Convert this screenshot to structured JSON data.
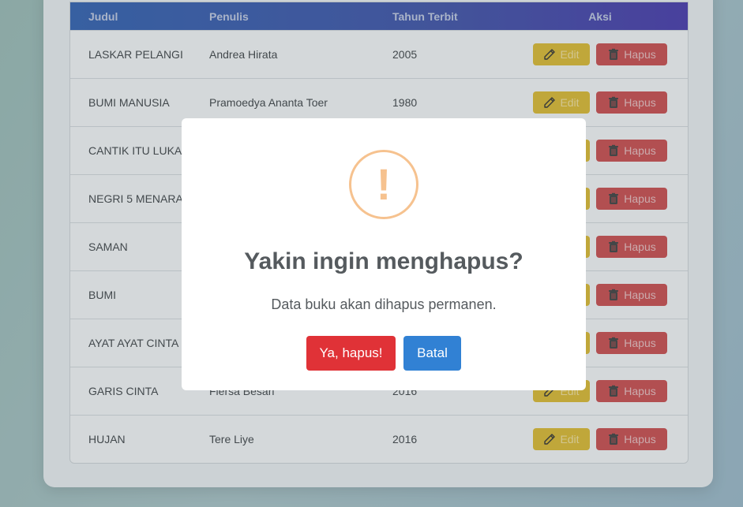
{
  "table": {
    "headers": {
      "judul": "Judul",
      "penulis": "Penulis",
      "tahun": "Tahun Terbit",
      "aksi": "Aksi"
    },
    "edit_label": "Edit",
    "hapus_label": "Hapus",
    "rows": [
      {
        "judul": "LASKAR PELANGI",
        "penulis": "Andrea Hirata",
        "tahun": "2005"
      },
      {
        "judul": "BUMI MANUSIA",
        "penulis": "Pramoedya Ananta Toer",
        "tahun": "1980"
      },
      {
        "judul": "CANTIK ITU LUKA",
        "penulis": "",
        "tahun": ""
      },
      {
        "judul": "NEGRI 5 MENARA",
        "penulis": "",
        "tahun": ""
      },
      {
        "judul": "SAMAN",
        "penulis": "",
        "tahun": ""
      },
      {
        "judul": "BUMI",
        "penulis": "",
        "tahun": ""
      },
      {
        "judul": "AYAT AYAT CINTA",
        "penulis": "",
        "tahun": ""
      },
      {
        "judul": "GARIS CINTA",
        "penulis": "Fiersa Besari",
        "tahun": "2016"
      },
      {
        "judul": "HUJAN",
        "penulis": "Tere Liye",
        "tahun": "2016"
      }
    ]
  },
  "modal": {
    "icon": "warning-icon",
    "icon_glyph": "!",
    "title": "Yakin ingin menghapus?",
    "text": "Data buku akan dihapus permanen.",
    "confirm_label": "Ya, hapus!",
    "cancel_label": "Batal"
  },
  "colors": {
    "header_start": "#1b4fa8",
    "header_end": "#3423a2",
    "edit": "#d9b21a",
    "hapus": "#c5383a",
    "confirm": "#e03237",
    "cancel": "#3181d4",
    "warning": "#f6c28f"
  }
}
